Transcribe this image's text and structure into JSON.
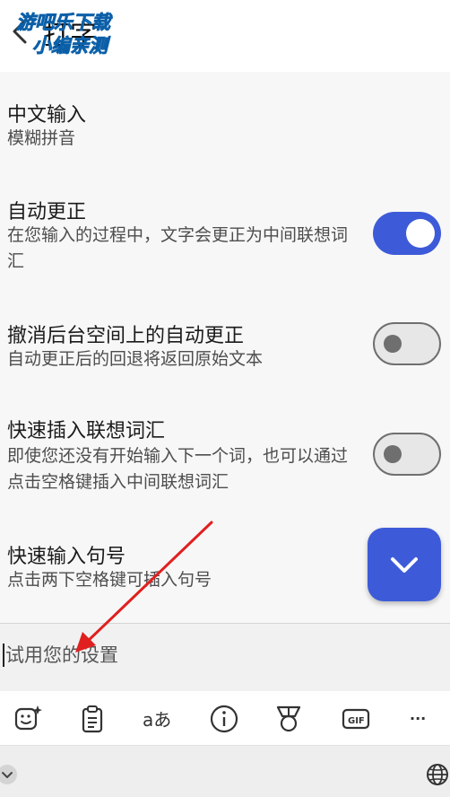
{
  "header": {
    "title": "打字",
    "watermark_line1": "游吧乐下载",
    "watermark_line2": "小编亲测"
  },
  "settings": [
    {
      "title": "中文输入",
      "desc": "模糊拼音"
    },
    {
      "title": "自动更正",
      "desc": "在您输入的过程中，文字会更正为中间联想词汇",
      "toggle": "on"
    },
    {
      "title": "撤消后台空间上的自动更正",
      "desc": "自动更正后的回退将返回原始文本",
      "toggle": "off"
    },
    {
      "title": "快速插入联想词汇",
      "desc": "即使您还没有开始输入下一个词，也可以通过点击空格键插入中间联想词汇",
      "toggle": "off"
    },
    {
      "title": "快速输入句号",
      "desc": "点击两下空格键可插入句号"
    }
  ],
  "trial_input": {
    "placeholder": "试用您的设置"
  },
  "toolbar": {
    "translate_label": "aあ",
    "gif_label": "GIF",
    "more_label": "···"
  },
  "colors": {
    "accent": "#3d5bd8",
    "annotation_arrow": "#e0201f"
  }
}
